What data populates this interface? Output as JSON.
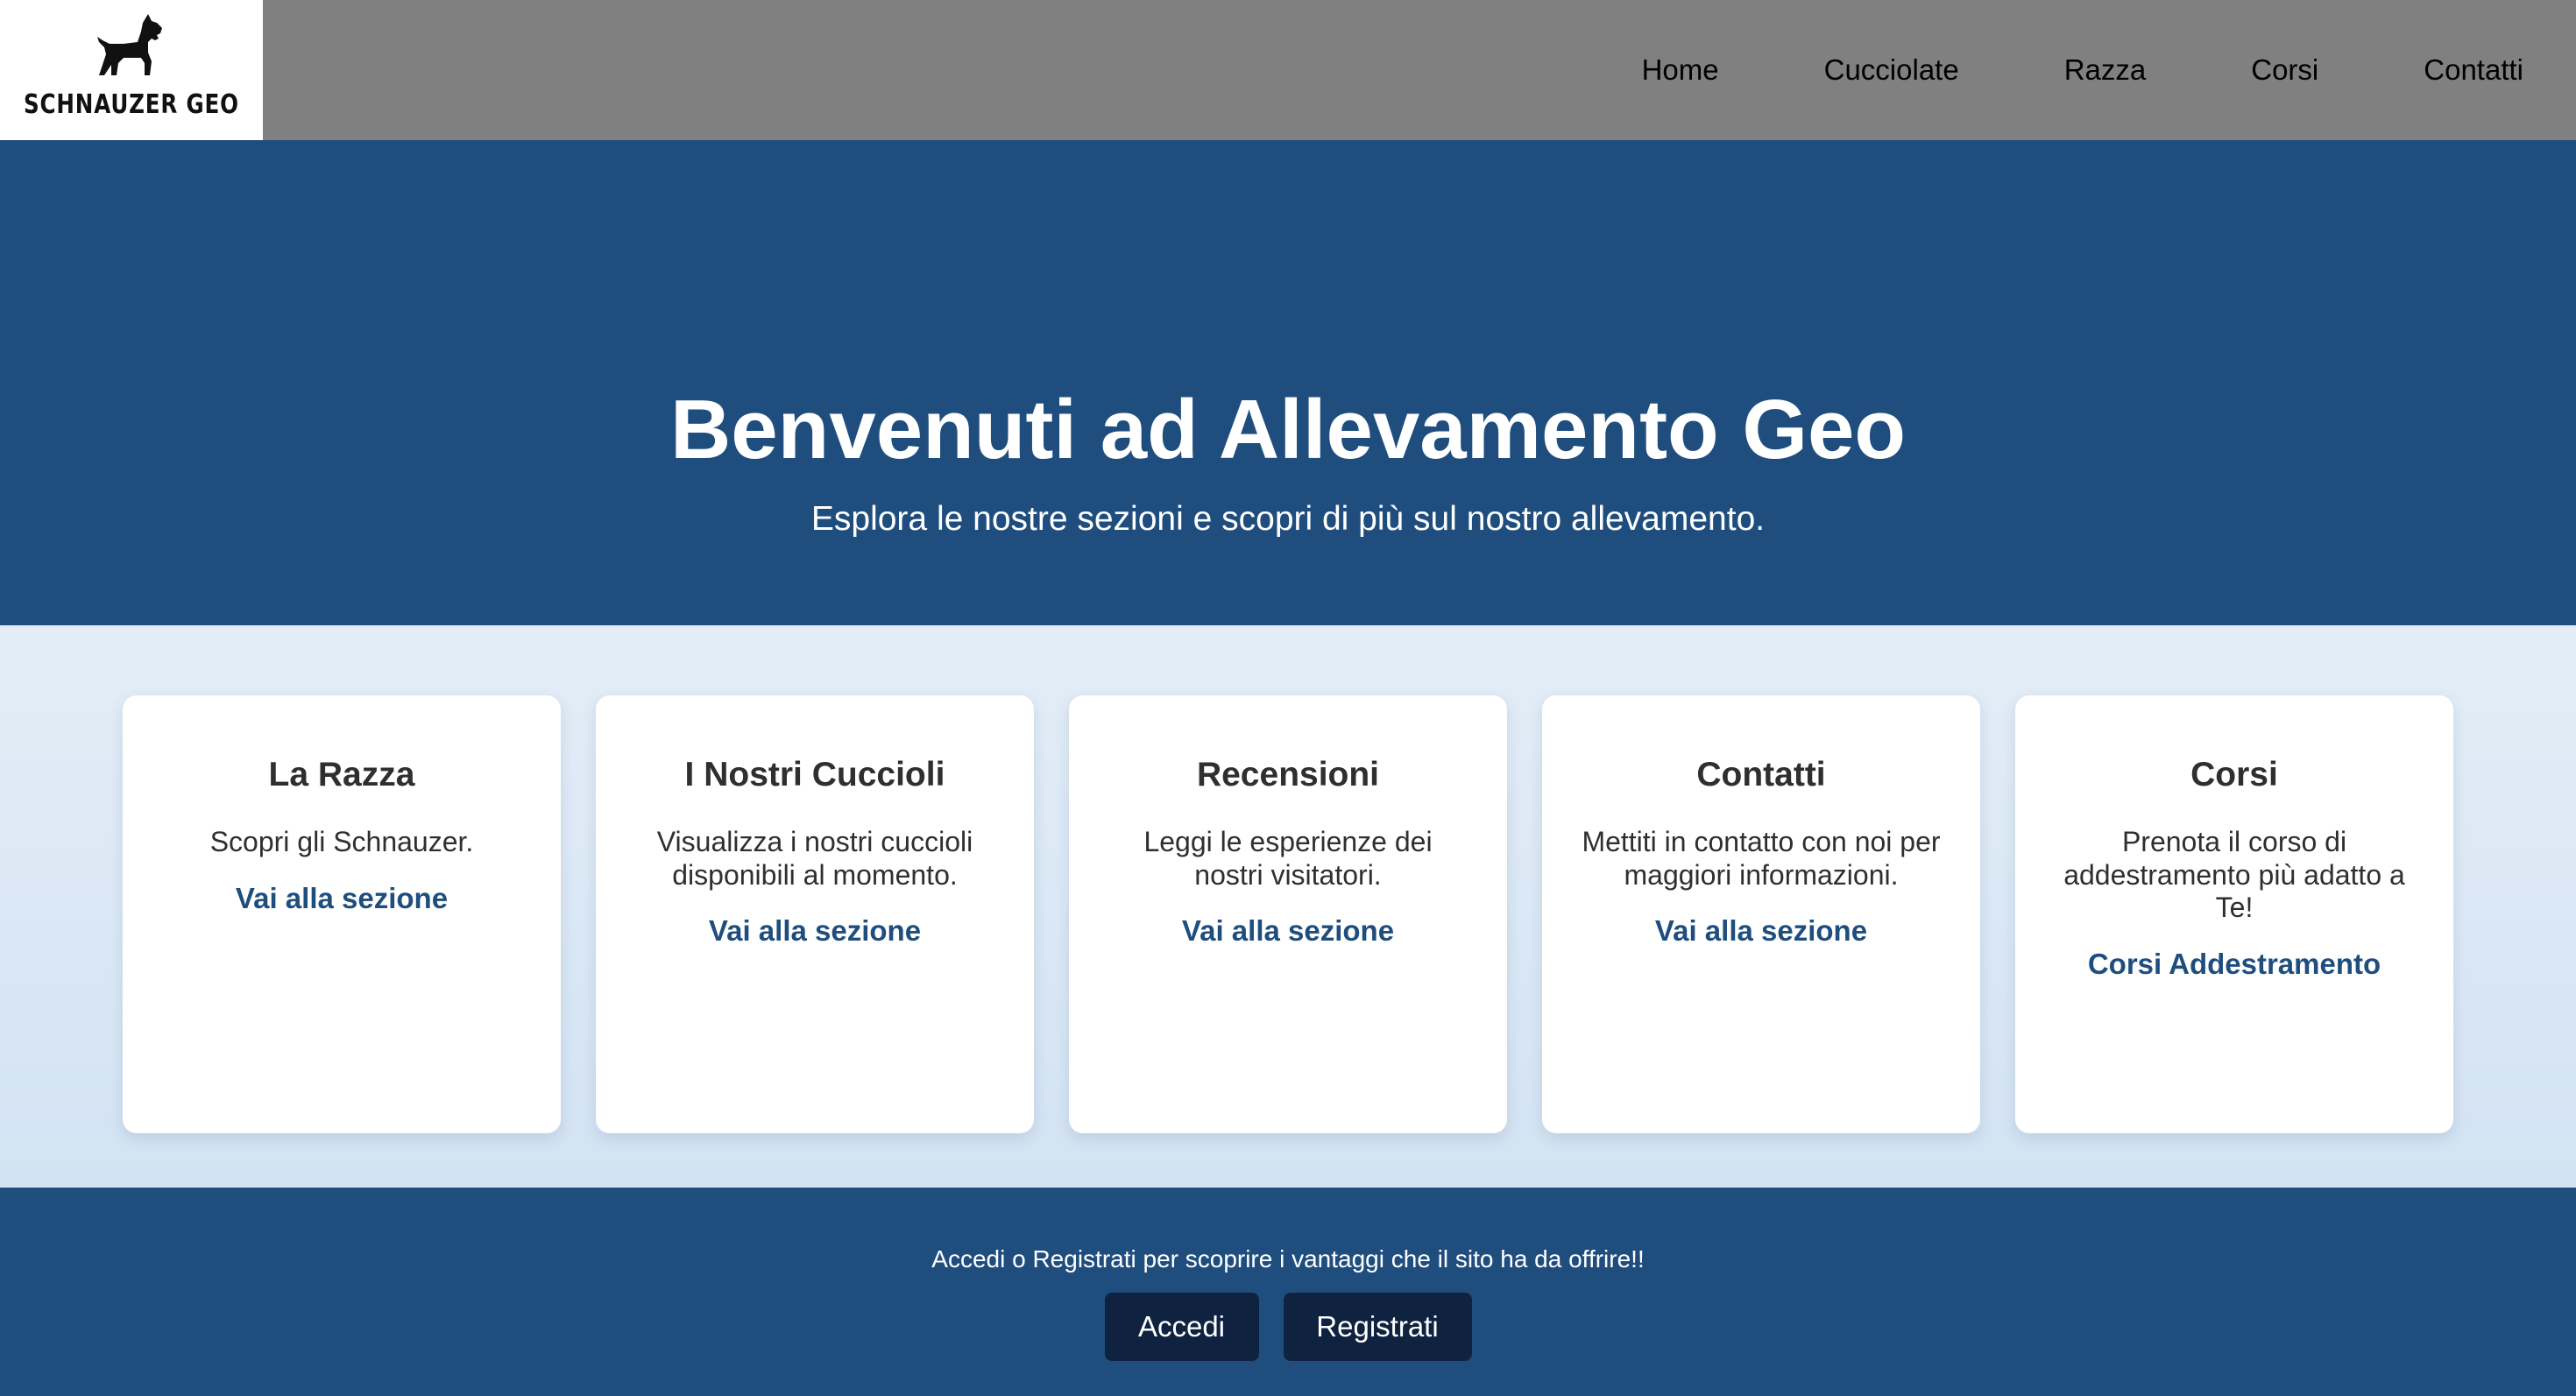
{
  "logo": {
    "text": "SCHNAUZER GEO",
    "icon": "schnauzer-dog-icon"
  },
  "nav": [
    {
      "label": "Home"
    },
    {
      "label": "Cucciolate"
    },
    {
      "label": "Razza"
    },
    {
      "label": "Corsi"
    },
    {
      "label": "Contatti"
    }
  ],
  "hero": {
    "title": "Benvenuti ad Allevamento Geo",
    "subtitle": "Esplora le nostre sezioni e scopri di più sul nostro allevamento."
  },
  "cards": [
    {
      "title": "La Razza",
      "desc": "Scopri gli Schnauzer.",
      "link": "Vai alla sezione"
    },
    {
      "title": "I Nostri Cuccioli",
      "desc": "Visualizza i nostri cuccioli disponibili al momento.",
      "link": "Vai alla sezione"
    },
    {
      "title": "Recensioni",
      "desc": "Leggi le esperienze dei nostri visitatori.",
      "link": "Vai alla sezione"
    },
    {
      "title": "Contatti",
      "desc": "Mettiti in contatto con noi per maggiori informazioni.",
      "link": "Vai alla sezione"
    },
    {
      "title": "Corsi",
      "desc": "Prenota il corso di addestramento più adatto a Te!",
      "link": "Corsi Addestramento"
    }
  ],
  "footer": {
    "message": "Accedi o Registrati per scoprire i vantaggi che il sito ha da offrire!!",
    "login_label": "Accedi",
    "register_label": "Registrati"
  },
  "colors": {
    "primary": "#1f4e7e",
    "header": "#808080",
    "button": "#0f2340",
    "cards_background": "#dbe8f5"
  }
}
